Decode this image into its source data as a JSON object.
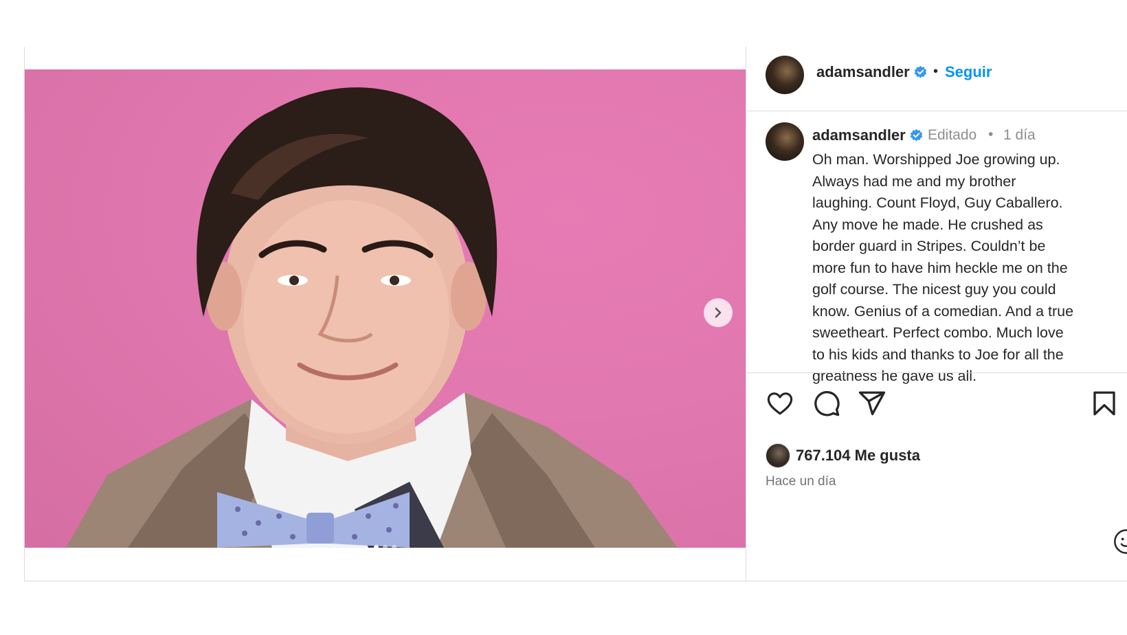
{
  "post": {
    "username": "adamsandler",
    "follow_label": "Seguir",
    "header_separator": "•",
    "more_label": "•••",
    "caption_meta": {
      "edited": "Editado",
      "separator": "•",
      "age": "1 día"
    },
    "caption_lines": [
      "Oh man. Worshipped Joe growing up.",
      "Always had me and my brother",
      "laughing. Count Floyd, Guy Caballero.",
      "Any move he made. He crushed as",
      "border guard in Stripes. Couldn’t be",
      "more fun to have him heckle me on the",
      "golf course. The nicest guy you could",
      "know. Genius of a comedian. And a true",
      "sweetheart. Perfect combo. Much love",
      "to his kids and thanks to Joe for all the",
      "greatness he gave us all."
    ],
    "likes": "767.104 Me gusta",
    "timestamp": "Hace un día"
  },
  "carousel": {
    "current_slide": 1,
    "total_slides": 3
  },
  "icons": {
    "verified": "verified-badge-icon",
    "like": "heart-icon",
    "comment": "comment-icon",
    "share": "share-icon",
    "save": "bookmark-icon",
    "next": "chevron-right-icon",
    "emoji": "emoji-icon",
    "more": "more-options-icon"
  },
  "colors": {
    "link": "#0095f6",
    "verified": "#3897f0",
    "photo_background": "#e278b0",
    "border": "#dbdbdb",
    "muted_text": "#8e8e8e"
  }
}
